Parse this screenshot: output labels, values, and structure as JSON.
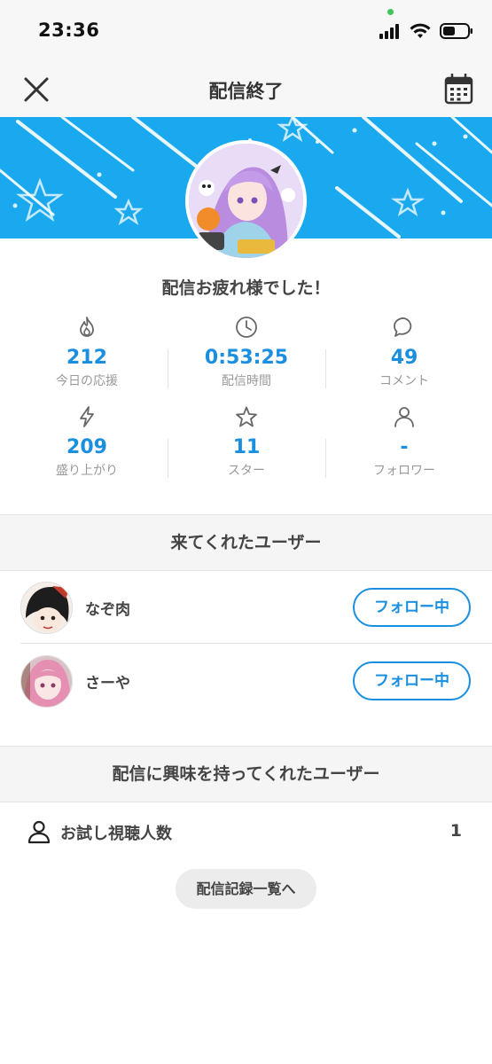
{
  "status_bar": {
    "time": "23:36"
  },
  "nav": {
    "title": "配信終了",
    "close_icon": "close-icon",
    "calendar_icon": "calendar-icon"
  },
  "banner": {
    "color": "#1aa9ee"
  },
  "thanks_message": "配信お疲れ様でした！",
  "stats": [
    {
      "icon": "flame-icon",
      "value": "212",
      "label": "今日の応援"
    },
    {
      "icon": "clock-icon",
      "value": "0:53:25",
      "label": "配信時間"
    },
    {
      "icon": "chat-bubble-icon",
      "value": "49",
      "label": "コメント"
    },
    {
      "icon": "lightning-icon",
      "value": "209",
      "label": "盛り上がり"
    },
    {
      "icon": "star-icon",
      "value": "11",
      "label": "スター"
    },
    {
      "icon": "person-icon",
      "value": "-",
      "label": "フォロワー"
    }
  ],
  "visitors_section": {
    "title": "来てくれたユーザー",
    "users": [
      {
        "name": "なぞ肉",
        "button": "フォロー中"
      },
      {
        "name": "さーや",
        "button": "フォロー中"
      }
    ]
  },
  "interested_section": {
    "title": "配信に興味を持ってくれたユーザー",
    "trial_label": "お試し視聴人数",
    "trial_count": "1"
  },
  "history_button": "配信記録一覧へ",
  "accent_color": "#1a8fe0"
}
